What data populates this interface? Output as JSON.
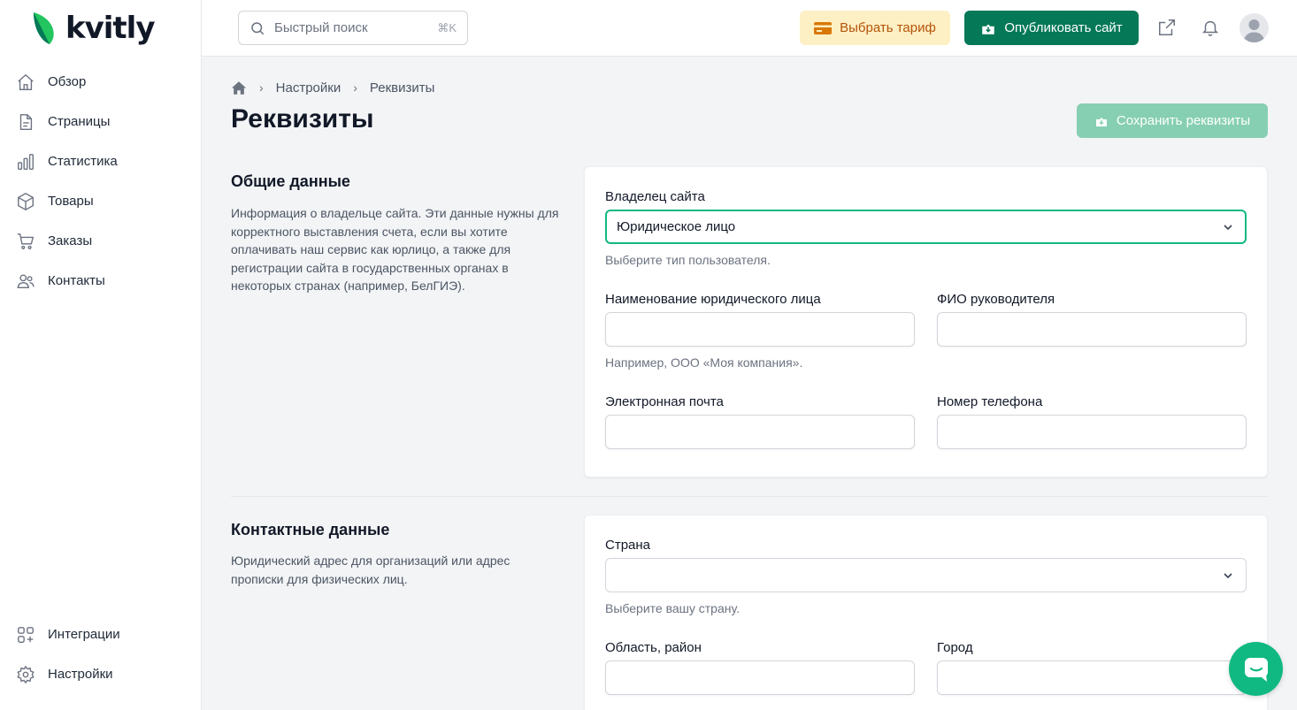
{
  "brand": {
    "name": "kvitly",
    "accent": "#10b981",
    "dark_green": "#047857"
  },
  "sidebar": {
    "items": [
      {
        "label": "Обзор",
        "icon": "home-icon"
      },
      {
        "label": "Страницы",
        "icon": "document-icon"
      },
      {
        "label": "Статистика",
        "icon": "chart-icon"
      },
      {
        "label": "Товары",
        "icon": "box-icon"
      },
      {
        "label": "Заказы",
        "icon": "cart-icon"
      },
      {
        "label": "Контакты",
        "icon": "users-icon"
      }
    ],
    "bottom_items": [
      {
        "label": "Интеграции",
        "icon": "integrations-icon"
      },
      {
        "label": "Настройки",
        "icon": "gear-icon"
      }
    ]
  },
  "header": {
    "search_placeholder": "Быстрый поиск",
    "search_shortcut": "⌘K",
    "tariff_label": "Выбрать тариф",
    "publish_label": "Опубликовать сайт"
  },
  "breadcrumb": {
    "items": [
      "Настройки",
      "Реквизиты"
    ]
  },
  "page": {
    "title": "Реквизиты",
    "save_label": "Сохранить реквизиты"
  },
  "general": {
    "title": "Общие данные",
    "description": "Информация о владельце сайта. Эти данные нужны для корректного выставления счета, если вы хотите оплачивать наш сервис как юрлицо, а также для регистрации сайта в государственных органах в некоторых странах (например, БелГИЭ).",
    "owner_label": "Владелец сайта",
    "owner_value": "Юридическое лицо",
    "owner_hint": "Выберите тип пользователя.",
    "company_label": "Наименование юридического лица",
    "company_value": "",
    "company_hint": "Например, ООО «Моя компания».",
    "director_label": "ФИО руководителя",
    "director_value": "",
    "email_label": "Электронная почта",
    "email_value": "",
    "phone_label": "Номер телефона",
    "phone_value": ""
  },
  "contact": {
    "title": "Контактные данные",
    "description": "Юридический адрес для организаций или адрес прописки для физических лиц.",
    "country_label": "Страна",
    "country_value": "",
    "country_hint": "Выберите вашу страну.",
    "region_label": "Область, район",
    "region_value": "",
    "city_label": "Город",
    "city_value": ""
  }
}
